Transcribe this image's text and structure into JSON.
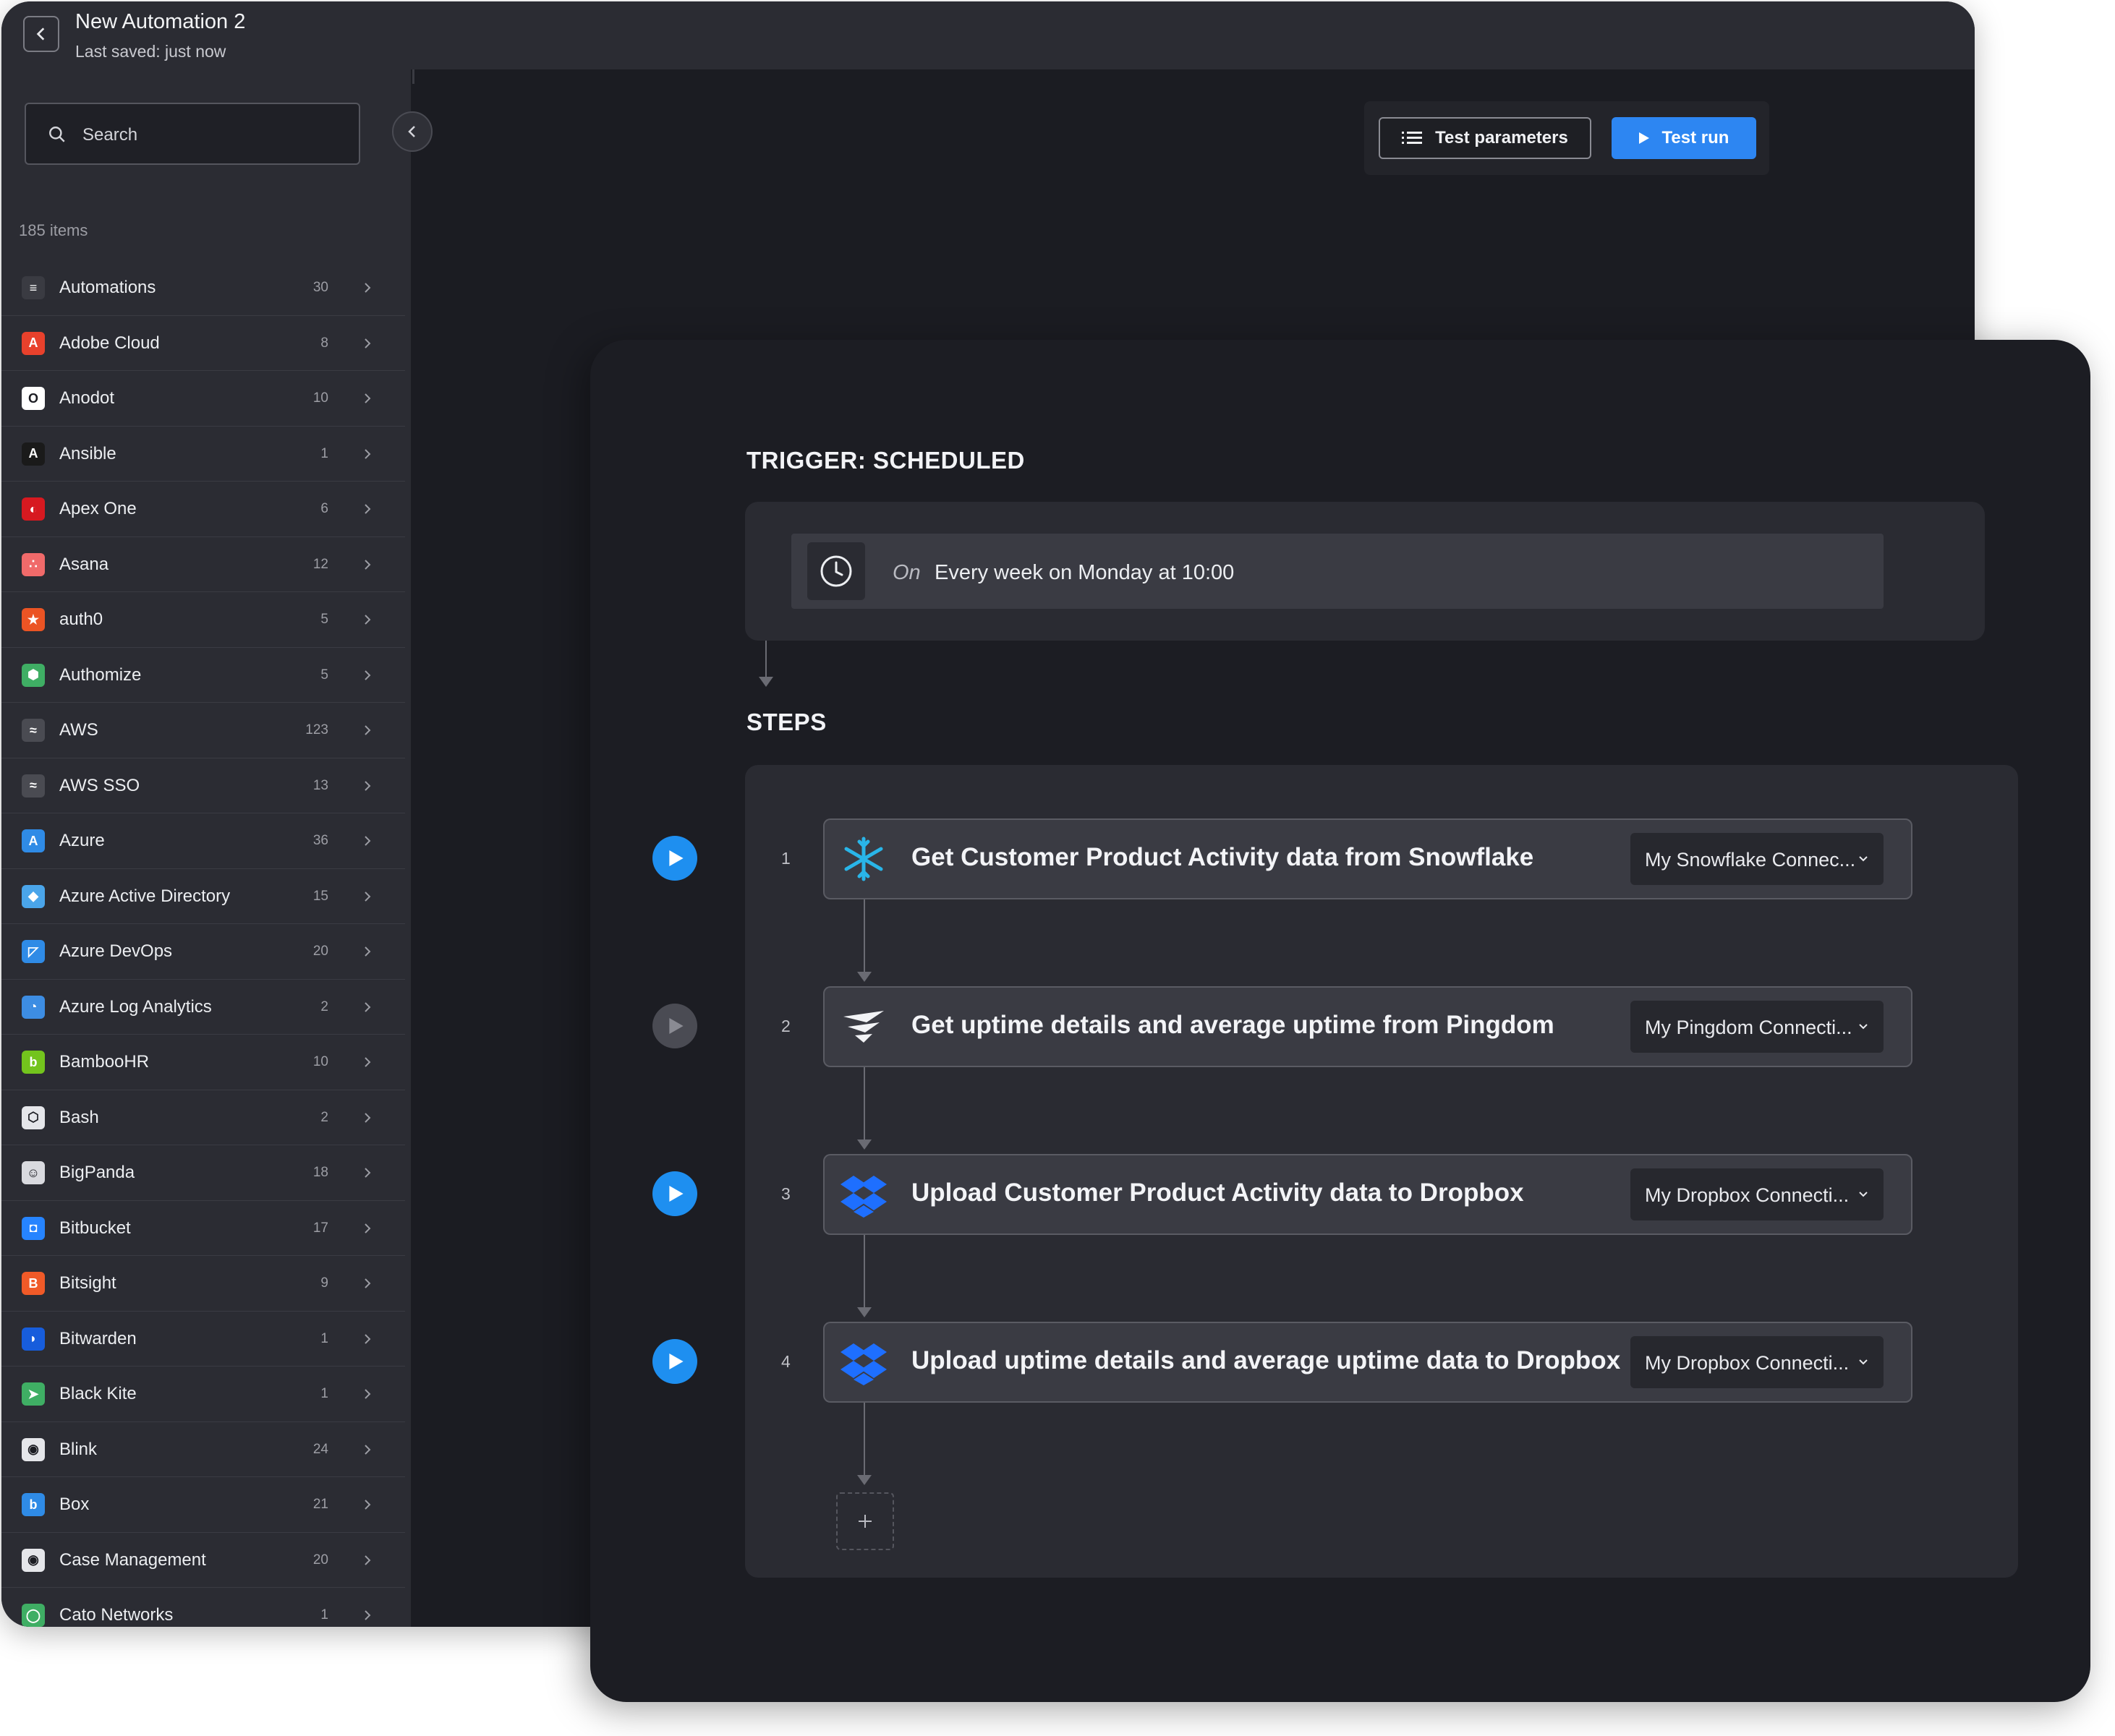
{
  "header": {
    "title": "New Automation 2",
    "subtitle": "Last saved: just now"
  },
  "sidebar": {
    "search": {
      "placeholder": "Search",
      "value": ""
    },
    "items_count": "185 items",
    "items": [
      {
        "label": "Automations",
        "count": "30",
        "icon": "automations-icon",
        "color": "#3a3b42"
      },
      {
        "label": "Adobe Cloud",
        "count": "8",
        "icon": "adobe-icon",
        "color": "#e8412c"
      },
      {
        "label": "Anodot",
        "count": "10",
        "icon": "anodot-icon",
        "color": "#ffffff"
      },
      {
        "label": "Ansible",
        "count": "1",
        "icon": "ansible-icon",
        "color": "#1a1a1a"
      },
      {
        "label": "Apex One",
        "count": "6",
        "icon": "apex-one-icon",
        "color": "#d71920"
      },
      {
        "label": "Asana",
        "count": "12",
        "icon": "asana-icon",
        "color": "#f06a6a"
      },
      {
        "label": "auth0",
        "count": "5",
        "icon": "auth0-icon",
        "color": "#eb5424"
      },
      {
        "label": "Authomize",
        "count": "5",
        "icon": "authomize-icon",
        "color": "#3fae64"
      },
      {
        "label": "AWS",
        "count": "123",
        "icon": "aws-icon",
        "color": "#4a4b52"
      },
      {
        "label": "AWS SSO",
        "count": "13",
        "icon": "aws-sso-icon",
        "color": "#4a4b52"
      },
      {
        "label": "Azure",
        "count": "36",
        "icon": "azure-icon",
        "color": "#2f8be6"
      },
      {
        "label": "Azure Active Directory",
        "count": "15",
        "icon": "azure-ad-icon",
        "color": "#4aa5ea"
      },
      {
        "label": "Azure DevOps",
        "count": "20",
        "icon": "azure-devops-icon",
        "color": "#2f8be6"
      },
      {
        "label": "Azure Log Analytics",
        "count": "2",
        "icon": "azure-log-analytics-icon",
        "color": "#3d8de3"
      },
      {
        "label": "BambooHR",
        "count": "10",
        "icon": "bamboohr-icon",
        "color": "#73c41d"
      },
      {
        "label": "Bash",
        "count": "2",
        "icon": "bash-icon",
        "color": "#e5e6ea"
      },
      {
        "label": "BigPanda",
        "count": "18",
        "icon": "bigpanda-icon",
        "color": "#d9dadf"
      },
      {
        "label": "Bitbucket",
        "count": "17",
        "icon": "bitbucket-icon",
        "color": "#2684ff"
      },
      {
        "label": "Bitsight",
        "count": "9",
        "icon": "bitsight-icon",
        "color": "#f05a28"
      },
      {
        "label": "Bitwarden",
        "count": "1",
        "icon": "bitwarden-icon",
        "color": "#175ddc"
      },
      {
        "label": "Black Kite",
        "count": "1",
        "icon": "black-kite-icon",
        "color": "#3fae64"
      },
      {
        "label": "Blink",
        "count": "24",
        "icon": "blink-icon",
        "color": "#e5e6ea"
      },
      {
        "label": "Box",
        "count": "21",
        "icon": "box-icon",
        "color": "#2f8be6"
      },
      {
        "label": "Case Management",
        "count": "20",
        "icon": "case-management-icon",
        "color": "#e5e6ea"
      },
      {
        "label": "Cato Networks",
        "count": "1",
        "icon": "cato-networks-icon",
        "color": "#3fae64"
      }
    ]
  },
  "toolbar": {
    "test_parameters_label": "Test parameters",
    "test_run_label": "Test run"
  },
  "trigger": {
    "heading": "TRIGGER: SCHEDULED",
    "prefix": "On",
    "schedule": "Every week on Monday at 10:00"
  },
  "steps": {
    "heading": "STEPS",
    "items": [
      {
        "number": "1",
        "title": "Get Customer Product Activity data from Snowflake",
        "connection": "My Snowflake Connec...",
        "icon": "snowflake-icon",
        "play_active": true
      },
      {
        "number": "2",
        "title": "Get uptime details and average uptime from Pingdom",
        "connection": "My Pingdom Connecti...",
        "icon": "pingdom-icon",
        "play_active": false
      },
      {
        "number": "3",
        "title": "Upload Customer Product Activity data to Dropbox",
        "connection": "My Dropbox Connecti...",
        "icon": "dropbox-icon",
        "play_active": true
      },
      {
        "number": "4",
        "title": "Upload uptime details and average uptime data to Dropbox",
        "connection": "My Dropbox Connecti...",
        "icon": "dropbox-icon",
        "play_active": true
      }
    ]
  },
  "colors": {
    "accent": "#2d86f2",
    "play_active": "#1e8ff0",
    "play_inactive": "#4a4b53"
  }
}
